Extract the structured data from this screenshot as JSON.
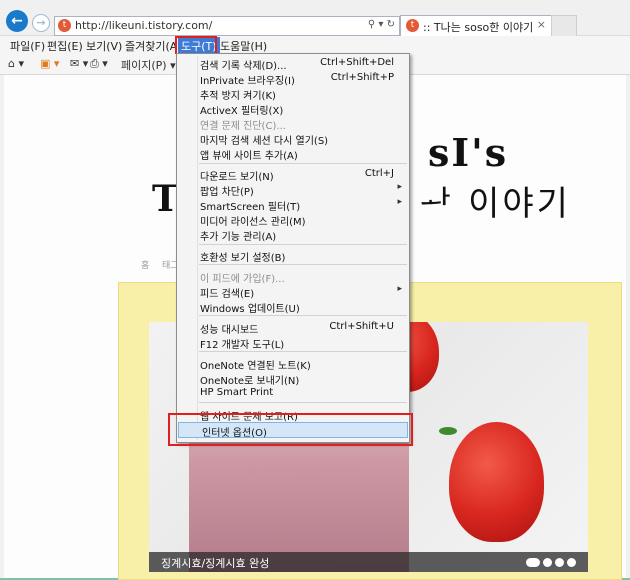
{
  "browser": {
    "url": "http://likeuni.tistory.com/",
    "tab_title": ":: T나는 soso한 이야기",
    "favicon_letter": "t",
    "tab_close": "×"
  },
  "menubar": [
    "파일(F)",
    "편집(E)",
    "보기(V)",
    "즐겨찾기(A)",
    "도구(T)",
    "도움말(H)"
  ],
  "commandbar": {
    "page_label": "페이지(P)"
  },
  "tools_menu": [
    {
      "label": "검색 기록 삭제(D)...",
      "shortcut": "Ctrl+Shift+Del"
    },
    {
      "label": "InPrivate 브라우징(I)",
      "shortcut": "Ctrl+Shift+P"
    },
    {
      "label": "추적 방지 켜기(K)"
    },
    {
      "label": "ActiveX 필터링(X)"
    },
    {
      "label": "연결 문제 진단(C)...",
      "disabled": true
    },
    {
      "label": "마지막 검색 세션 다시 열기(S)"
    },
    {
      "label": "앱 뷰에 사이트 추가(A)"
    },
    {
      "label": "다운로드 보기(N)",
      "shortcut": "Ctrl+J"
    },
    {
      "label": "팝업 차단(P)",
      "submenu": true
    },
    {
      "label": "SmartScreen 필터(T)",
      "submenu": true
    },
    {
      "label": "미디어 라이선스 관리(M)"
    },
    {
      "label": "추가 기능 관리(A)"
    },
    {
      "label": "호환성 보기 설정(B)"
    },
    {
      "label": "이 피드에 가입(F)...",
      "disabled": true
    },
    {
      "label": "피드 검색(E)",
      "submenu": true
    },
    {
      "label": "Windows 업데이트(U)"
    },
    {
      "label": "성능 대시보드",
      "shortcut": "Ctrl+Shift+U"
    },
    {
      "label": "F12 개발자 도구(L)"
    },
    {
      "label": "OneNote 연결된 노트(K)"
    },
    {
      "label": "OneNote로 보내기(N)"
    },
    {
      "label": "HP Smart Print"
    },
    {
      "label": "웹 사이트 문제 보고(R)"
    },
    {
      "label": "인터넷 옵션(O)",
      "highlighted": true
    }
  ],
  "blog": {
    "title_fragment": "sI's",
    "subtitle_fragment": "ᅪ 이야기",
    "logo_fragment": "T",
    "nav": [
      "홈",
      "태그"
    ],
    "caption": "징계시효/징계시효 완성"
  },
  "colors": {
    "accent": "#3d7bd5",
    "highlight_box": "#e02020",
    "menu_hover": "#d5e6f7"
  }
}
